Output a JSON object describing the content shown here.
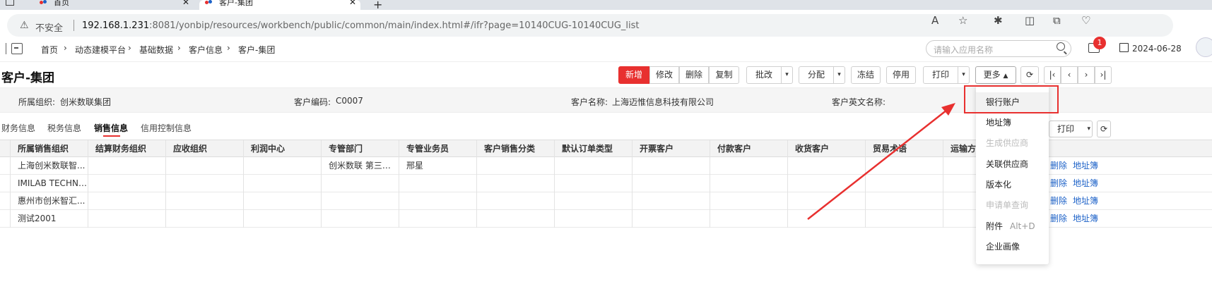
{
  "browser": {
    "tabs": [
      {
        "title": "首页"
      },
      {
        "title": "客户-集团"
      }
    ],
    "insecure_label": "不安全",
    "url_host": "192.168.1.231",
    "url_rest": ":8081/yonbip/resources/workbench/public/common/main/index.html#/ifr?page=10140CUG-10140CUG_list"
  },
  "header": {
    "breadcrumb": [
      "首页",
      "动态建模平台",
      "基础数据",
      "客户信息",
      "客户-集团"
    ],
    "search_placeholder": "请输入应用名称",
    "notification_count": "1",
    "date": "2024-06-28"
  },
  "page": {
    "title": "客户-集团"
  },
  "toolbar": {
    "add": "新增",
    "edit": "修改",
    "delete": "删除",
    "copy": "复制",
    "batch": "批改",
    "assign": "分配",
    "freeze": "冻结",
    "disable": "停用",
    "print": "打印",
    "more": "更多"
  },
  "info": {
    "org_label": "所属组织:",
    "org_value": "创米数联集团",
    "code_label": "客户编码:",
    "code_value": "C0007",
    "name_label": "客户名称:",
    "name_value": "上海迈惟信息科技有限公司",
    "en_name_label": "客户英文名称:"
  },
  "subtabs": [
    "财务信息",
    "税务信息",
    "销售信息",
    "信用控制信息"
  ],
  "subtoolbar": {
    "print": "打印"
  },
  "table": {
    "columns": [
      "所属销售组织",
      "结算财务组织",
      "应收组织",
      "利润中心",
      "专管部门",
      "专管业务员",
      "客户销售分类",
      "默认订单类型",
      "开票客户",
      "付款客户",
      "收货客户",
      "贸易术语",
      "运输方式"
    ],
    "rows": [
      [
        "上海创米数联智...",
        "",
        "",
        "",
        "创米数联 第三事...",
        "邢星",
        "",
        "",
        "",
        "",
        "",
        "",
        ""
      ],
      [
        "IMILAB TECHNOL...",
        "",
        "",
        "",
        "",
        "",
        "",
        "",
        "",
        "",
        "",
        "",
        ""
      ],
      [
        "惠州市创米智汇...",
        "",
        "",
        "",
        "",
        "",
        "",
        "",
        "",
        "",
        "",
        "",
        ""
      ],
      [
        "测试2001",
        "",
        "",
        "",
        "",
        "",
        "",
        "",
        "",
        "",
        "",
        "",
        ""
      ]
    ],
    "row_actions": [
      "删除",
      "地址簿"
    ]
  },
  "more_menu": {
    "items": [
      {
        "label": "银行账户",
        "disabled": false
      },
      {
        "label": "地址簿",
        "disabled": false
      },
      {
        "label": "生成供应商",
        "disabled": true
      },
      {
        "label": "关联供应商",
        "disabled": false
      },
      {
        "label": "版本化",
        "disabled": false
      },
      {
        "label": "申请单查询",
        "disabled": true
      },
      {
        "label": "附件",
        "disabled": false,
        "shortcut": "Alt+D"
      },
      {
        "label": "企业画像",
        "disabled": false
      }
    ]
  },
  "colors": {
    "accent": "#e8302f",
    "link": "#1d62c8",
    "arrow": "#e8302f"
  }
}
